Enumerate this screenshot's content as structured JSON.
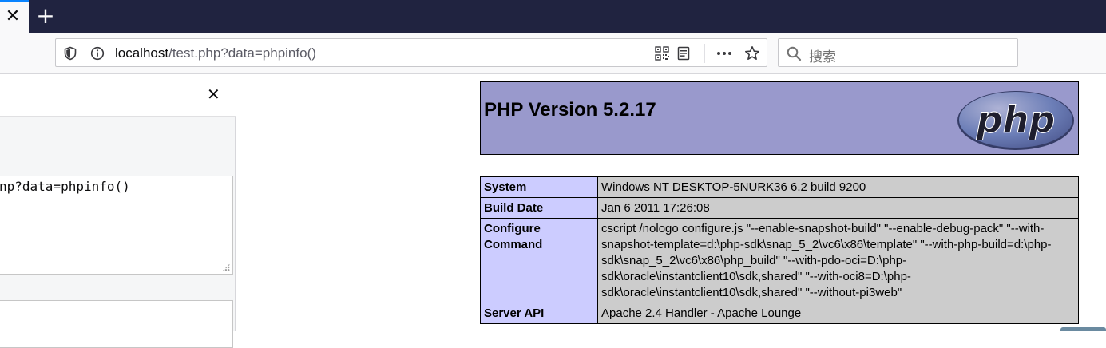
{
  "browser": {
    "tab_close_glyph": "✕",
    "new_tab_glyph": "+",
    "url_host": "localhost",
    "url_path": "/test.php?data=phpinfo()",
    "search_placeholder": "搜索"
  },
  "side_panel": {
    "close_glyph": "✕",
    "request_text": "np?data=phpinfo()"
  },
  "php": {
    "title": "PHP Version 5.2.17",
    "logo_text": "php",
    "rows": [
      {
        "key": "System",
        "value": "Windows NT DESKTOP-5NURK36 6.2 build 9200"
      },
      {
        "key": "Build Date",
        "value": "Jan 6 2011 17:26:08"
      },
      {
        "key": "Configure Command",
        "value": "cscript /nologo configure.js \"--enable-snapshot-build\" \"--enable-debug-pack\" \"--with-snapshot-template=d:\\php-sdk\\snap_5_2\\vc6\\x86\\template\" \"--with-php-build=d:\\php-sdk\\snap_5_2\\vc6\\x86\\php_build\" \"--with-pdo-oci=D:\\php-sdk\\oracle\\instantclient10\\sdk,shared\" \"--with-oci8=D:\\php-sdk\\oracle\\instantclient10\\sdk,shared\" \"--without-pi3web\""
      },
      {
        "key": "Server API",
        "value": "Apache 2.4 Handler - Apache Lounge"
      }
    ]
  },
  "colors": {
    "tabstrip": "#202340",
    "accent": "#0a84ff",
    "php_header": "#9999cc",
    "key_cell": "#ccccff",
    "value_cell": "#cccccc"
  }
}
